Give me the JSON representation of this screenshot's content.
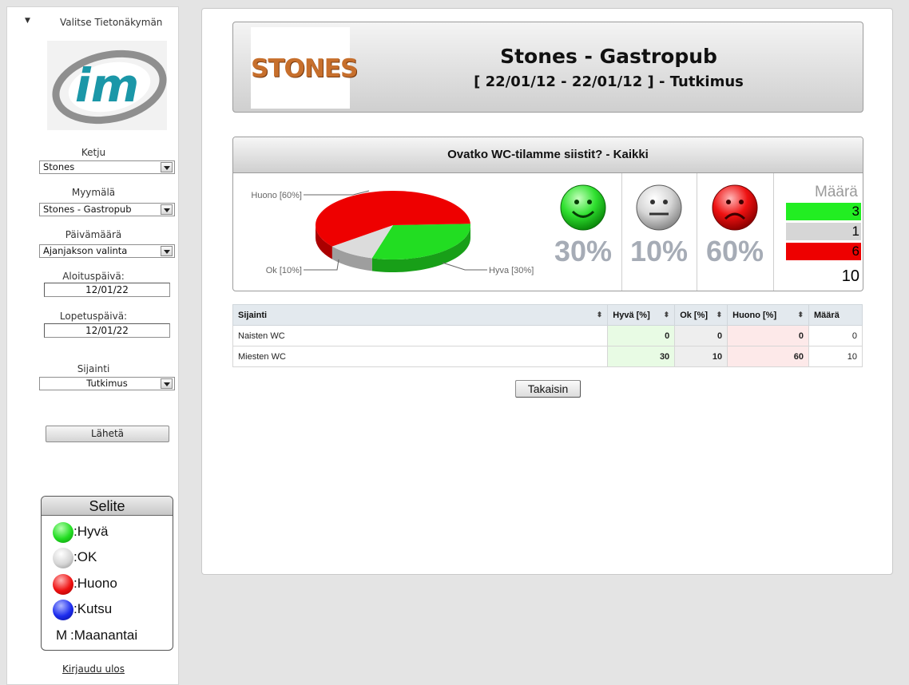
{
  "sidebar": {
    "header_title": "Valitse Tietonäkymän",
    "logo_text": "im",
    "chain": {
      "label": "Ketju",
      "value": "Stones"
    },
    "store": {
      "label": "Myymälä",
      "value": "Stones - Gastropub"
    },
    "date": {
      "label": "Päivämäärä",
      "value": "Ajanjakson valinta"
    },
    "start": {
      "label": "Aloituspäivä:",
      "value": "12/01/22"
    },
    "end": {
      "label": "Lopetuspäivä:",
      "value": "12/01/22"
    },
    "location": {
      "label": "Sijainti",
      "value": "Tutkimus"
    },
    "send_label": "Lähetä",
    "legend": {
      "title": "Selite",
      "good": ":Hyvä",
      "ok": ":OK",
      "bad": ":Huono",
      "invite": ":Kutsu",
      "monday_letter": "M",
      "monday": ":Maanantai"
    },
    "logout": "Kirjaudu ulos"
  },
  "header": {
    "brand": "STONES",
    "title": "Stones - Gastropub",
    "subtitle": "[ 22/01/12 - 22/01/12 ] - Tutkimus"
  },
  "question": {
    "title": "Ovatko WC-tilamme siistit? - Kaikki",
    "good_pct": "30%",
    "ok_pct": "10%",
    "bad_pct": "60%",
    "count_header": "Määrä",
    "counts": {
      "good": "3",
      "ok": "1",
      "bad": "6",
      "total": "10"
    },
    "colors": {
      "good": "#22dd22",
      "ok": "#d4d4d4",
      "bad": "#ee0000"
    }
  },
  "chart_data": {
    "type": "pie",
    "labels": [
      "Huono [60%]",
      "Ok [10%]",
      "Hyva [30%]"
    ],
    "values": [
      60,
      10,
      30
    ],
    "colors": [
      "#ee0000",
      "#dcdcdc",
      "#22dd22"
    ]
  },
  "table": {
    "headers": {
      "location": "Sijainti",
      "good": "Hyvä [%]",
      "ok": "Ok [%]",
      "bad": "Huono [%]",
      "count": "Määrä"
    },
    "rows": [
      {
        "location": "Naisten WC",
        "good": "0",
        "ok": "0",
        "bad": "0",
        "count": "0"
      },
      {
        "location": "Miesten WC",
        "good": "30",
        "ok": "10",
        "bad": "60",
        "count": "10"
      }
    ]
  },
  "back_label": "Takaisin"
}
